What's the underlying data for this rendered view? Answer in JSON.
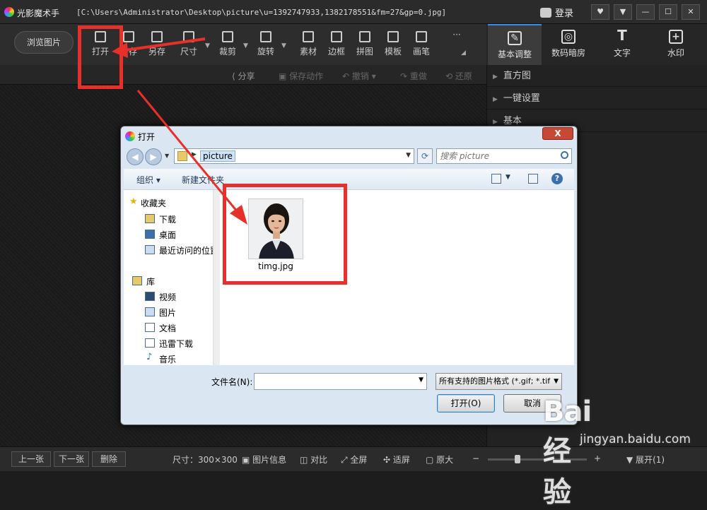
{
  "app": {
    "name": "光影魔术手",
    "title_path": "[C:\\Users\\Administrator\\Desktop\\picture\\u=1392747933,1382178551&fm=27&gp=0.jpg]",
    "login_label": "登录",
    "window_controls": [
      "♥",
      "▼",
      "—",
      "☐",
      "✕"
    ]
  },
  "toolbar": {
    "browse_label": "浏览图片",
    "tools": [
      {
        "label": "打开",
        "icon": "open-image-icon"
      },
      {
        "label": "另存",
        "icon": "save-icon"
      },
      {
        "label": "另存",
        "icon": "save-as-icon"
      },
      {
        "label": "尺寸",
        "icon": "resize-icon"
      },
      {
        "label": "裁剪",
        "icon": "crop-icon"
      },
      {
        "label": "旋转",
        "icon": "rotate-icon"
      },
      {
        "label": "素材",
        "icon": "material-icon"
      },
      {
        "label": "边框",
        "icon": "frame-icon"
      },
      {
        "label": "拼图",
        "icon": "collage-icon"
      },
      {
        "label": "模板",
        "icon": "template-icon"
      },
      {
        "label": "画笔",
        "icon": "brush-icon"
      }
    ],
    "more": "···"
  },
  "subbar": {
    "share": "分享",
    "save_action": "保存动作",
    "undo": "撤销",
    "redo": "重做",
    "restore": "还原"
  },
  "panel_tabs": [
    {
      "label": "基本调整",
      "icon": "basic-adjust-icon",
      "active": true
    },
    {
      "label": "数码暗房",
      "icon": "darkroom-icon",
      "active": false
    },
    {
      "label": "文字",
      "icon": "text-icon",
      "active": false
    },
    {
      "label": "水印",
      "icon": "watermark-icon",
      "active": false
    }
  ],
  "right_panel": {
    "items": [
      "直方图",
      "一键设置",
      "基本"
    ]
  },
  "bottombar": {
    "prev": "上一张",
    "next": "下一张",
    "delete": "删除",
    "size": "尺寸：300×300",
    "image_info": "图片信息",
    "compare": "对比",
    "fullscreen": "全屏",
    "fit": "适屏",
    "original": "原大",
    "expand": "展开",
    "expand_count": "(1)"
  },
  "dialog": {
    "title": "打开",
    "close": "X",
    "crumb": "picture",
    "search_placeholder": "搜索 picture",
    "organize": "组织 ▾",
    "new_folder": "新建文件夹",
    "nav": {
      "favorites": "收藏夹",
      "fav_items": [
        "下载",
        "桌面",
        "最近访问的位置"
      ],
      "library": "库",
      "lib_items": [
        "视频",
        "图片",
        "文档",
        "迅雷下载",
        "音乐"
      ]
    },
    "file": {
      "name": "timg.jpg"
    },
    "filename_label": "文件名(N):",
    "filename_value": "",
    "filetype": "所有支持的图片格式 (*.gif; *.tif",
    "open_button": "打开(O)",
    "cancel_button": "取消"
  },
  "watermark": {
    "brand": "Bai 经验",
    "url": "jingyan.baidu.com"
  },
  "colors": {
    "annotation_red": "#e8302a",
    "active_tab_accent": "#3a8ee6"
  }
}
